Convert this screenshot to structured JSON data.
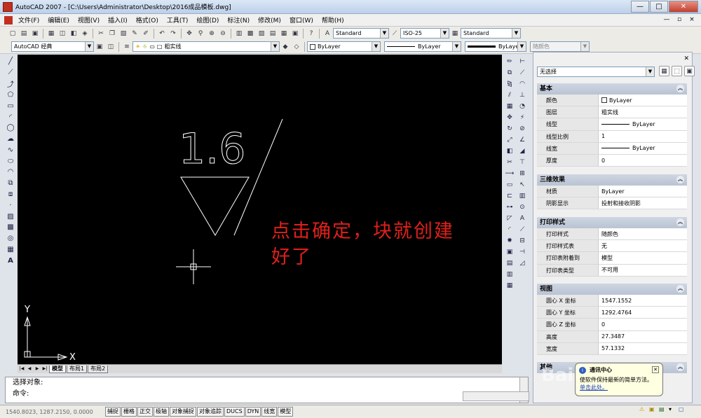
{
  "window": {
    "title": "AutoCAD 2007 - [C:\\Users\\Administrator\\Desktop\\2016成品模板.dwg]",
    "minimize": "—",
    "maximize": "□",
    "close": "✕"
  },
  "menu": [
    "文件(F)",
    "编辑(E)",
    "视图(V)",
    "插入(I)",
    "格式(O)",
    "工具(T)",
    "绘图(D)",
    "标注(N)",
    "修改(M)",
    "窗口(W)",
    "帮助(H)"
  ],
  "doc_controls": [
    "—",
    "▫",
    "×"
  ],
  "toolbar1": {
    "text_style": "Standard",
    "dim_style": "ISO-25",
    "table_style": "Standard"
  },
  "toolbar2": {
    "workspace": "AutoCAD 经典",
    "layer": "粗实线",
    "color": "ByLayer",
    "linetype": "ByLayer",
    "lineweight": "ByLayer",
    "plotstyle": "随颜色"
  },
  "canvas": {
    "drawing_text": "1.6",
    "annotation_line1": "点击确定，块就创建",
    "annotation_line2": "好了",
    "ucs_y": "Y",
    "ucs_x": "X",
    "background": "#000000",
    "annotation_color": "#e0201a"
  },
  "layout_tabs": [
    "模型",
    "布局1",
    "布局2"
  ],
  "command": {
    "line1": "选择对象:",
    "line2": "命令:"
  },
  "status": {
    "coords": "1540.8023, 1287.2150, 0.0000",
    "buttons": [
      "捕捉",
      "栅格",
      "正交",
      "极轴",
      "对象捕捉",
      "对象追踪",
      "DUCS",
      "DYN",
      "线宽",
      "模型"
    ]
  },
  "properties": {
    "selection": "无选择",
    "sections": [
      {
        "title": "基本",
        "rows": [
          {
            "key": "颜色",
            "value": "ByLayer",
            "kind": "color"
          },
          {
            "key": "图层",
            "value": "粗实线"
          },
          {
            "key": "线型",
            "value": "ByLayer",
            "kind": "line"
          },
          {
            "key": "线型比例",
            "value": "1"
          },
          {
            "key": "线宽",
            "value": "ByLayer",
            "kind": "line"
          },
          {
            "key": "厚度",
            "value": "0"
          }
        ]
      },
      {
        "title": "三维效果",
        "rows": [
          {
            "key": "材质",
            "value": "ByLayer"
          },
          {
            "key": "阴影显示",
            "value": "投射和接收阴影"
          }
        ]
      },
      {
        "title": "打印样式",
        "rows": [
          {
            "key": "打印样式",
            "value": "随颜色"
          },
          {
            "key": "打印样式表",
            "value": "无"
          },
          {
            "key": "打印表附着到",
            "value": "模型"
          },
          {
            "key": "打印表类型",
            "value": "不可用"
          }
        ]
      },
      {
        "title": "视图",
        "rows": [
          {
            "key": "圆心 X 坐标",
            "value": "1547.1552"
          },
          {
            "key": "圆心 Y 坐标",
            "value": "1292.4764"
          },
          {
            "key": "圆心 Z 坐标",
            "value": "0"
          },
          {
            "key": "高度",
            "value": "27.3487"
          },
          {
            "key": "宽度",
            "value": "57.1332"
          }
        ]
      },
      {
        "title": "其他",
        "rows": []
      }
    ]
  },
  "balloon": {
    "title": "通讯中心",
    "body": "使软件保持最新的简单方法。",
    "link": "单击此处。"
  },
  "watermark": "Baidu经验"
}
